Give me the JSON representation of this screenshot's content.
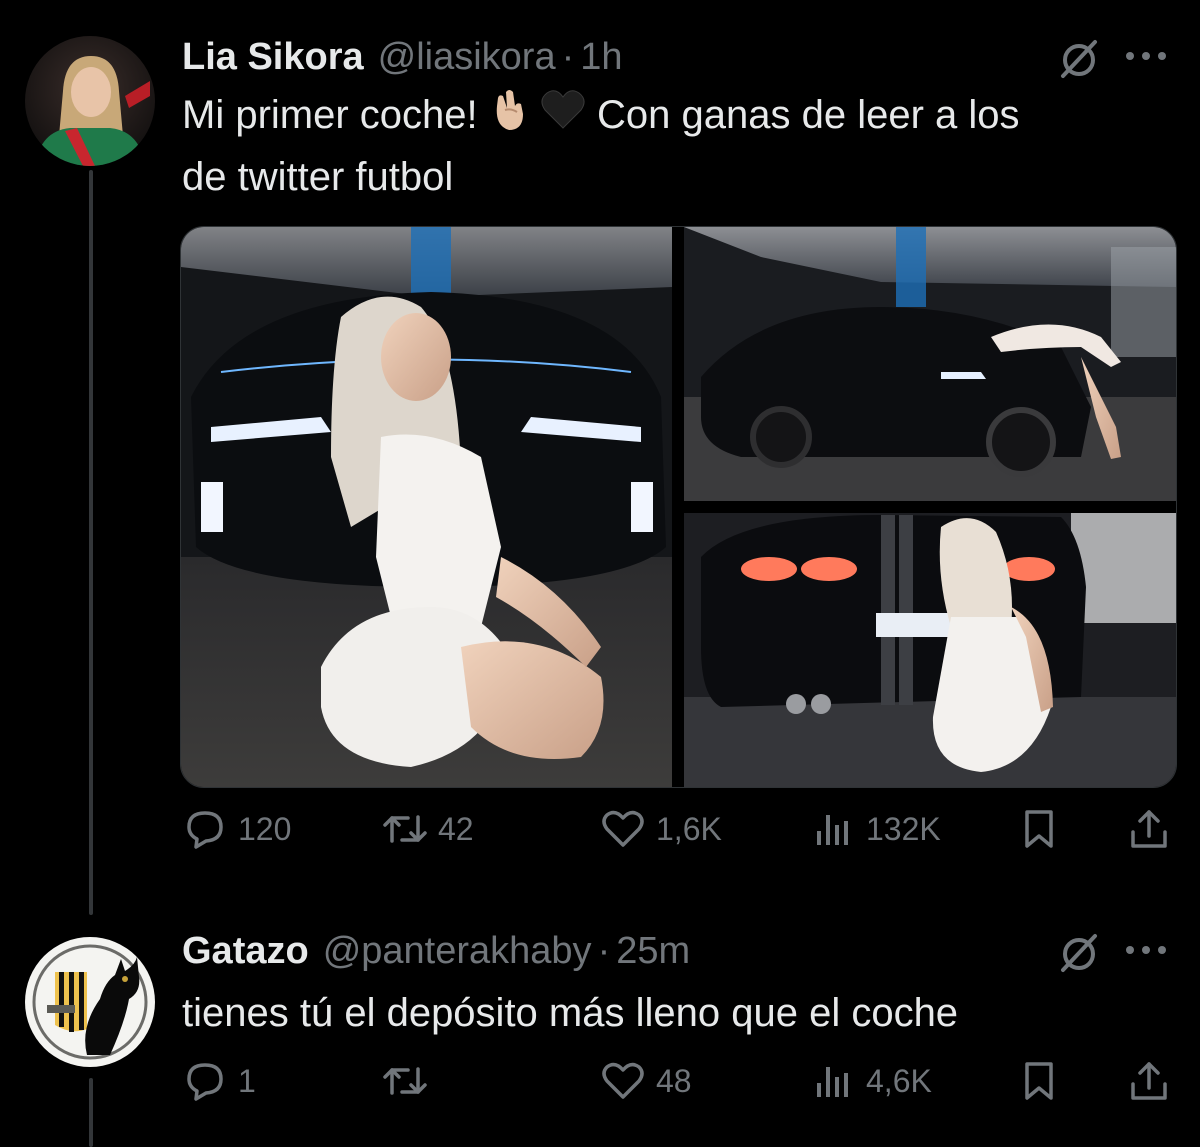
{
  "tweet": {
    "display_name": "Lia Sikora",
    "handle": "@liasikora",
    "separator": "·",
    "time": "1h",
    "text_line1_a": "Mi primer coche!",
    "text_line1_b": "Con ganas de leer a los",
    "text_line2": "de twitter futbol",
    "emojis": [
      "crossed-fingers",
      "black-heart"
    ],
    "media": [
      "photo-woman-kneeling-front-of-black-car",
      "photo-woman-lying-on-car-hood",
      "photo-woman-crouching-at-car-rear"
    ],
    "stats": {
      "replies": "120",
      "reposts": "42",
      "likes": "1,6K",
      "views": "132K"
    }
  },
  "reply": {
    "display_name": "Gatazo",
    "handle": "@panterakhaby",
    "separator": "·",
    "time": "25m",
    "text": "tienes tú el depósito más lleno que el coche",
    "stats": {
      "replies": "1",
      "reposts": "",
      "likes": "48",
      "views": "4,6K"
    }
  },
  "colors": {
    "background": "#000000",
    "text": "#e7e9ea",
    "muted": "#71767b",
    "line": "#333639"
  }
}
